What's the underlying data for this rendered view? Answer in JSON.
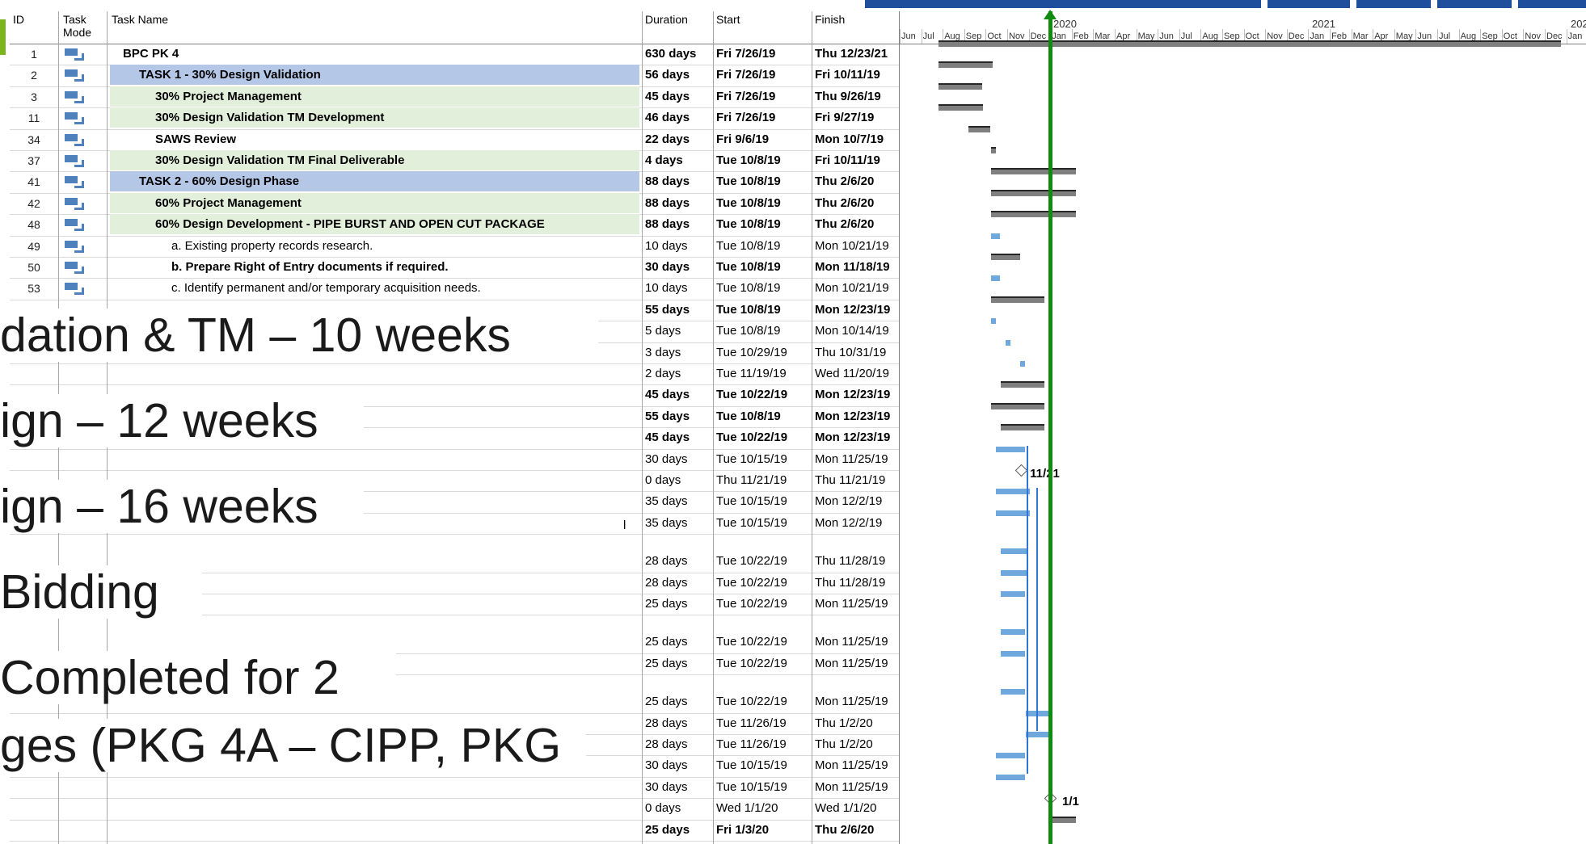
{
  "headers": {
    "id": "ID",
    "mode": "Task Mode",
    "name": "Task Name",
    "duration": "Duration",
    "start": "Start",
    "finish": "Finish"
  },
  "timeline": {
    "years": [
      "2020",
      "2021",
      "202"
    ],
    "months": [
      "Jun",
      "Jul",
      "Aug",
      "Sep",
      "Oct",
      "Nov",
      "Dec",
      "Jan",
      "Feb",
      "Mar",
      "Apr",
      "May",
      "Jun",
      "Jul",
      "Aug",
      "Sep",
      "Oct",
      "Nov",
      "Dec",
      "Jan",
      "Feb",
      "Mar",
      "Apr",
      "May",
      "Jun",
      "Jul",
      "Aug",
      "Sep",
      "Oct",
      "Nov",
      "Dec",
      "Jan"
    ]
  },
  "rows": [
    {
      "id": "1",
      "name": "BPC PK 4",
      "duration": "630 days",
      "start": "Fri 7/26/19",
      "finish": "Thu 12/23/21",
      "bold": true,
      "hl": "",
      "indent": 0
    },
    {
      "id": "2",
      "name": "TASK 1 - 30% Design Validation",
      "duration": "56 days",
      "start": "Fri 7/26/19",
      "finish": "Fri 10/11/19",
      "bold": true,
      "hl": "blue",
      "indent": 1
    },
    {
      "id": "3",
      "name": "30% Project Management",
      "duration": "45 days",
      "start": "Fri 7/26/19",
      "finish": "Thu 9/26/19",
      "bold": true,
      "hl": "green",
      "indent": 2
    },
    {
      "id": "11",
      "name": "30% Design Validation TM Development",
      "duration": "46 days",
      "start": "Fri 7/26/19",
      "finish": "Fri 9/27/19",
      "bold": true,
      "hl": "green",
      "indent": 2
    },
    {
      "id": "34",
      "name": "SAWS Review",
      "duration": "22 days",
      "start": "Fri 9/6/19",
      "finish": "Mon 10/7/19",
      "bold": true,
      "hl": "",
      "indent": 2
    },
    {
      "id": "37",
      "name": "30% Design Validation TM Final Deliverable",
      "duration": "4 days",
      "start": "Tue 10/8/19",
      "finish": "Fri 10/11/19",
      "bold": true,
      "hl": "green",
      "indent": 2
    },
    {
      "id": "41",
      "name": "TASK 2 - 60% Design Phase",
      "duration": "88 days",
      "start": "Tue 10/8/19",
      "finish": "Thu 2/6/20",
      "bold": true,
      "hl": "blue",
      "indent": 1
    },
    {
      "id": "42",
      "name": "60% Project Management",
      "duration": "88 days",
      "start": "Tue 10/8/19",
      "finish": "Thu 2/6/20",
      "bold": true,
      "hl": "green",
      "indent": 2
    },
    {
      "id": "48",
      "name": "60% Design Development - PIPE BURST AND OPEN CUT PACKAGE",
      "duration": "88 days",
      "start": "Tue 10/8/19",
      "finish": "Thu 2/6/20",
      "bold": true,
      "hl": "green",
      "indent": 2
    },
    {
      "id": "49",
      "name": "a. Existing property records research.",
      "duration": "10 days",
      "start": "Tue 10/8/19",
      "finish": "Mon 10/21/19",
      "bold": false,
      "hl": "",
      "indent": 3
    },
    {
      "id": "50",
      "name": "b. Prepare Right of Entry documents if required.",
      "duration": "30 days",
      "start": "Tue 10/8/19",
      "finish": "Mon 11/18/19",
      "bold": true,
      "hl": "",
      "indent": 3
    },
    {
      "id": "53",
      "name": "c. Identify permanent and/or temporary acquisition needs.",
      "duration": "10 days",
      "start": "Tue 10/8/19",
      "finish": "Mon 10/21/19",
      "bold": false,
      "hl": "",
      "indent": 3
    },
    {
      "id": "",
      "name": "",
      "duration": "55 days",
      "start": "Tue 10/8/19",
      "finish": "Mon 12/23/19",
      "bold": true,
      "hl": "",
      "indent": 0
    },
    {
      "id": "",
      "name": "",
      "duration": "5 days",
      "start": "Tue 10/8/19",
      "finish": "Mon 10/14/19",
      "bold": false,
      "hl": "",
      "indent": 0
    },
    {
      "id": "",
      "name": "",
      "duration": "3 days",
      "start": "Tue 10/29/19",
      "finish": "Thu 10/31/19",
      "bold": false,
      "hl": "",
      "indent": 0
    },
    {
      "id": "",
      "name": "",
      "duration": "2 days",
      "start": "Tue 11/19/19",
      "finish": "Wed 11/20/19",
      "bold": false,
      "hl": "",
      "indent": 0
    },
    {
      "id": "",
      "name": "",
      "duration": "45 days",
      "start": "Tue 10/22/19",
      "finish": "Mon 12/23/19",
      "bold": true,
      "hl": "",
      "indent": 0
    },
    {
      "id": "",
      "name": "",
      "duration": "55 days",
      "start": "Tue 10/8/19",
      "finish": "Mon 12/23/19",
      "bold": true,
      "hl": "",
      "indent": 0
    },
    {
      "id": "",
      "name": "",
      "duration": "45 days",
      "start": "Tue 10/22/19",
      "finish": "Mon 12/23/19",
      "bold": true,
      "hl": "",
      "indent": 0
    },
    {
      "id": "",
      "name": "",
      "duration": "30 days",
      "start": "Tue 10/15/19",
      "finish": "Mon 11/25/19",
      "bold": false,
      "hl": "",
      "indent": 0
    },
    {
      "id": "",
      "name": "",
      "duration": "0 days",
      "start": "Thu 11/21/19",
      "finish": "Thu 11/21/19",
      "bold": false,
      "hl": "",
      "indent": 0
    },
    {
      "id": "",
      "name": "",
      "duration": "35 days",
      "start": "Tue 10/15/19",
      "finish": "Mon 12/2/19",
      "bold": false,
      "hl": "",
      "indent": 0
    },
    {
      "id": "",
      "name": "",
      "duration": "35 days",
      "start": "Tue 10/15/19",
      "finish": "Mon 12/2/19",
      "bold": false,
      "hl": "",
      "indent": 0
    },
    {
      "id": "",
      "name": "",
      "duration": "",
      "start": "",
      "finish": "",
      "bold": false,
      "hl": "",
      "indent": 0
    },
    {
      "id": "",
      "name": "",
      "duration": "28 days",
      "start": "Tue 10/22/19",
      "finish": "Thu 11/28/19",
      "bold": false,
      "hl": "",
      "indent": 0
    },
    {
      "id": "",
      "name": "",
      "duration": "28 days",
      "start": "Tue 10/22/19",
      "finish": "Thu 11/28/19",
      "bold": false,
      "hl": "",
      "indent": 0
    },
    {
      "id": "",
      "name": "",
      "duration": "25 days",
      "start": "Tue 10/22/19",
      "finish": "Mon 11/25/19",
      "bold": false,
      "hl": "",
      "indent": 0
    },
    {
      "id": "",
      "name": "",
      "duration": "",
      "start": "",
      "finish": "",
      "bold": false,
      "hl": "",
      "indent": 0
    },
    {
      "id": "",
      "name": "",
      "duration": "25 days",
      "start": "Tue 10/22/19",
      "finish": "Mon 11/25/19",
      "bold": false,
      "hl": "",
      "indent": 0
    },
    {
      "id": "",
      "name": "",
      "duration": "25 days",
      "start": "Tue 10/22/19",
      "finish": "Mon 11/25/19",
      "bold": false,
      "hl": "",
      "indent": 0
    },
    {
      "id": "",
      "name": "",
      "duration": "",
      "start": "",
      "finish": "",
      "bold": false,
      "hl": "",
      "indent": 0
    },
    {
      "id": "",
      "name": "",
      "duration": "25 days",
      "start": "Tue 10/22/19",
      "finish": "Mon 11/25/19",
      "bold": false,
      "hl": "",
      "indent": 0
    },
    {
      "id": "",
      "name": "",
      "duration": "28 days",
      "start": "Tue 11/26/19",
      "finish": "Thu 1/2/20",
      "bold": false,
      "hl": "",
      "indent": 0
    },
    {
      "id": "",
      "name": "",
      "duration": "28 days",
      "start": "Tue 11/26/19",
      "finish": "Thu 1/2/20",
      "bold": false,
      "hl": "",
      "indent": 0
    },
    {
      "id": "",
      "name": "",
      "duration": "30 days",
      "start": "Tue 10/15/19",
      "finish": "Mon 11/25/19",
      "bold": false,
      "hl": "",
      "indent": 0
    },
    {
      "id": "",
      "name": "",
      "duration": "30 days",
      "start": "Tue 10/15/19",
      "finish": "Mon 11/25/19",
      "bold": false,
      "hl": "",
      "indent": 0
    },
    {
      "id": "",
      "name": "",
      "duration": "0 days",
      "start": "Wed 1/1/20",
      "finish": "Wed 1/1/20",
      "bold": false,
      "hl": "",
      "indent": 0
    },
    {
      "id": "",
      "name": "",
      "duration": "25 days",
      "start": "Fri 1/3/20",
      "finish": "Thu 2/6/20",
      "bold": true,
      "hl": "",
      "indent": 0
    }
  ],
  "milestones": [
    {
      "label": "11/21"
    },
    {
      "label": "1/1"
    }
  ],
  "slide": {
    "line1": "dation & TM – 10 weeks",
    "line2": "ign – 12 weeks",
    "line3": "ign – 16 weeks",
    "line4": "Bidding",
    "line5": "Completed for 2",
    "line6": "ges (PKG 4A – CIPP, PKG"
  },
  "cut_marker": "l",
  "colors": {
    "blue_hl": "#b4c7e7",
    "green_hl": "#e2efda",
    "today": "#118a11",
    "bar_blue": "#6fa8dc"
  }
}
